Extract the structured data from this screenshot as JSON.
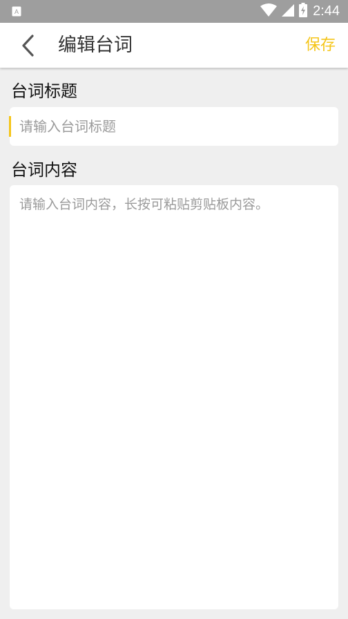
{
  "status_bar": {
    "time": "2:44",
    "icons": [
      "app-notification-icon",
      "wifi-icon",
      "cell-signal-icon",
      "battery-charging-icon"
    ]
  },
  "app_bar": {
    "title": "编辑台词",
    "save_label": "保存",
    "back_icon": "chevron-left-icon"
  },
  "form": {
    "title_label": "台词标题",
    "title_placeholder": "请输入台词标题",
    "title_value": "",
    "content_label": "台词内容",
    "content_placeholder": "请输入台词内容，长按可粘贴剪贴板内容。",
    "content_value": ""
  },
  "colors": {
    "accent": "#f5c518",
    "status_bar": "#9e9e9e",
    "background": "#efefef",
    "field_background": "#ffffff",
    "placeholder": "#9a9a9a"
  }
}
